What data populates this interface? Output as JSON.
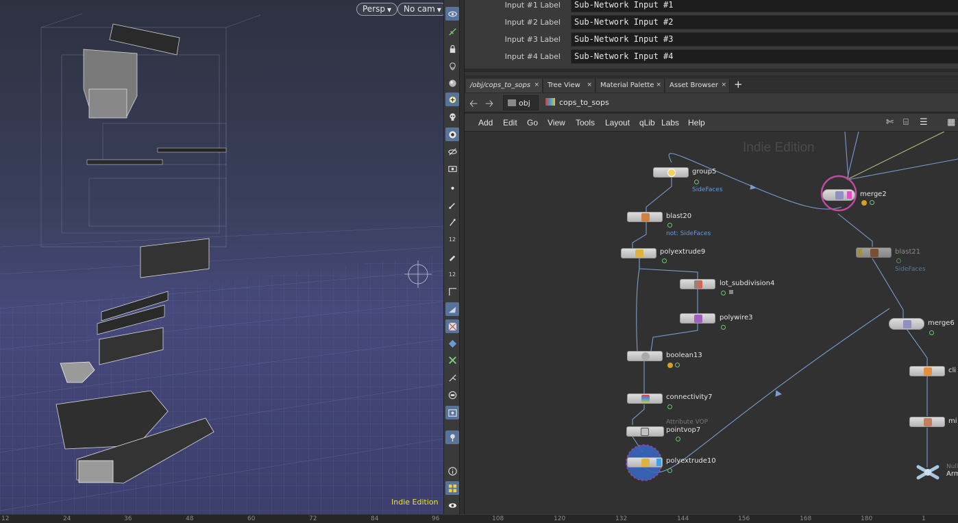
{
  "viewport": {
    "camera_view": "Persp",
    "camera": "No cam",
    "watermark": "Indie Edition"
  },
  "toolbar": {
    "tools": [
      "view-icon",
      "pose-icon",
      "lock-icon",
      "ghost-icon",
      "sphere-icon",
      "snap-icon",
      "skull-icon",
      "camera-icon",
      "eye-icon",
      "display-icon",
      "point-icon",
      "brush-icon",
      "pick-icon",
      "twelve-icon",
      "paint-icon",
      "twelve-b-icon",
      "corner-icon",
      "cone-icon",
      "checker-icon",
      "diamond-icon",
      "grid-icon",
      "scissor-icon",
      "box-icon",
      "screenshot-icon",
      "pin-icon",
      "info-icon",
      "layout-icon",
      "eye-b-icon"
    ],
    "label_12a": "12",
    "label_12b": "12"
  },
  "params": {
    "rows": [
      {
        "label": "Input #1 Label",
        "value": "Sub-Network Input #1"
      },
      {
        "label": "Input #2 Label",
        "value": "Sub-Network Input #2"
      },
      {
        "label": "Input #3 Label",
        "value": "Sub-Network Input #3"
      },
      {
        "label": "Input #4 Label",
        "value": "Sub-Network Input #4"
      }
    ]
  },
  "tabs": [
    {
      "label": "/obj/cops_to_sops",
      "close": "×"
    },
    {
      "label": "Tree View",
      "close": "×"
    },
    {
      "label": "Material Palette",
      "close": "×"
    },
    {
      "label": "Asset Browser",
      "close": "×"
    }
  ],
  "tab_add": "+",
  "path": {
    "back": "🡠",
    "forward": "🡢",
    "root": "obj",
    "current": "cops_to_sops"
  },
  "menu": [
    "Add",
    "Edit",
    "Go",
    "View",
    "Tools",
    "Layout",
    "qLib",
    "Labs",
    "Help"
  ],
  "network": {
    "watermark": "Indie Edition",
    "nodes": {
      "group5": {
        "name": "group5",
        "sub": "SideFaces"
      },
      "blast20": {
        "name": "blast20",
        "sub": "not: SideFaces"
      },
      "polyextrude9": {
        "name": "polyextrude9"
      },
      "lot_subdivision4": {
        "name": "lot_subdivision4"
      },
      "polywire3": {
        "name": "polywire3"
      },
      "boolean13": {
        "name": "boolean13"
      },
      "connectivity7": {
        "name": "connectivity7"
      },
      "pointvop7": {
        "name": "pointvop7",
        "type": "Attribute VOP"
      },
      "polyextrude10": {
        "name": "polyextrude10"
      },
      "merge2": {
        "name": "merge2"
      },
      "blast21": {
        "name": "blast21",
        "sub": "SideFaces"
      },
      "merge6": {
        "name": "merge6"
      },
      "clip": {
        "name": "cli"
      },
      "mi": {
        "name": "mi"
      },
      "null": {
        "name": "Arm",
        "type": "Null"
      }
    },
    "colors": {
      "wire": "#7a9cd0",
      "flag_green": "#6ec46e",
      "display_blue": "#3a66c0",
      "template_pink": "#c04aa0",
      "bypass_yellow": "#e0c040"
    }
  },
  "timeline": {
    "ticks": [
      "12",
      "24",
      "36",
      "48",
      "60",
      "72",
      "84",
      "96",
      "108",
      "120",
      "132",
      "144",
      "156",
      "168",
      "180",
      "1"
    ]
  }
}
